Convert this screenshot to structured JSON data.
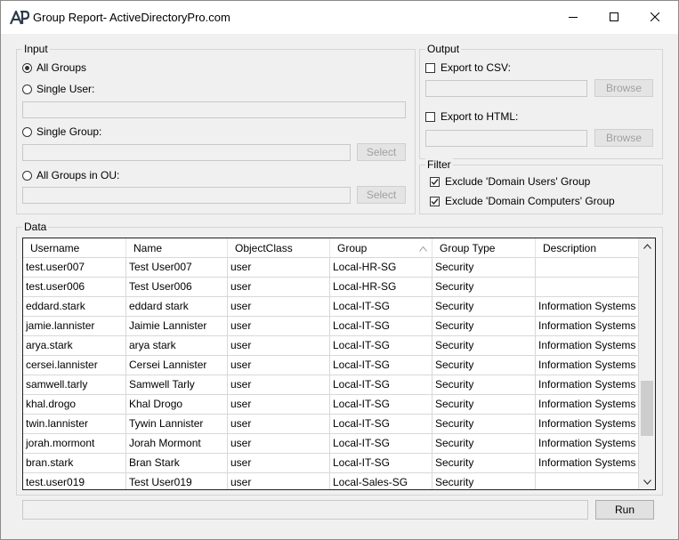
{
  "window": {
    "title": "Group Report- ActiveDirectoryPro.com",
    "icon": "activedirectorypro-logo-icon"
  },
  "input": {
    "label": "Input",
    "all_groups_label": "All Groups",
    "single_user_label": "Single User:",
    "single_user_value": "",
    "single_group_label": "Single Group:",
    "single_group_value": "",
    "single_group_select": "Select",
    "all_groups_in_ou_label": "All Groups in OU:",
    "ou_value": "",
    "ou_select": "Select",
    "selected": "all_groups"
  },
  "output": {
    "label": "Output",
    "export_csv_label": "Export to CSV:",
    "export_csv_checked": false,
    "csv_path": "",
    "csv_browse": "Browse",
    "export_html_label": "Export to HTML:",
    "export_html_checked": false,
    "html_path": "",
    "html_browse": "Browse"
  },
  "filter": {
    "label": "Filter",
    "exclude_domain_users_label": "Exclude 'Domain Users' Group",
    "exclude_domain_users_checked": true,
    "exclude_domain_computers_label": "Exclude 'Domain Computers' Group",
    "exclude_domain_computers_checked": true
  },
  "data": {
    "label": "Data",
    "columns": [
      "Username",
      "Name",
      "ObjectClass",
      "Group",
      "Group Type",
      "Description"
    ],
    "sorted_column": "Group",
    "rows": [
      [
        "test.user007",
        "Test User007",
        "user",
        "Local-HR-SG",
        "Security",
        ""
      ],
      [
        "test.user006",
        "Test User006",
        "user",
        "Local-HR-SG",
        "Security",
        ""
      ],
      [
        "eddard.stark",
        "eddard stark",
        "user",
        "Local-IT-SG",
        "Security",
        "Information Systems ..."
      ],
      [
        "jamie.lannister",
        "Jaimie Lannister",
        "user",
        "Local-IT-SG",
        "Security",
        "Information Systems ..."
      ],
      [
        "arya.stark",
        "arya stark",
        "user",
        "Local-IT-SG",
        "Security",
        "Information Systems ..."
      ],
      [
        "cersei.lannister",
        "Cersei Lannister",
        "user",
        "Local-IT-SG",
        "Security",
        "Information Systems ..."
      ],
      [
        "samwell.tarly",
        "Samwell Tarly",
        "user",
        "Local-IT-SG",
        "Security",
        "Information Systems ..."
      ],
      [
        "khal.drogo",
        "Khal Drogo",
        "user",
        "Local-IT-SG",
        "Security",
        "Information Systems ..."
      ],
      [
        "twin.lannister",
        "Tywin Lannister",
        "user",
        "Local-IT-SG",
        "Security",
        "Information Systems ..."
      ],
      [
        "jorah.mormont",
        "Jorah Mormont",
        "user",
        "Local-IT-SG",
        "Security",
        "Information Systems ..."
      ],
      [
        "bran.stark",
        "Bran Stark",
        "user",
        "Local-IT-SG",
        "Security",
        "Information Systems ..."
      ],
      [
        "test.user019",
        "Test User019",
        "user",
        "Local-Sales-SG",
        "Security",
        ""
      ]
    ]
  },
  "footer": {
    "status_text": "",
    "run_label": "Run"
  }
}
